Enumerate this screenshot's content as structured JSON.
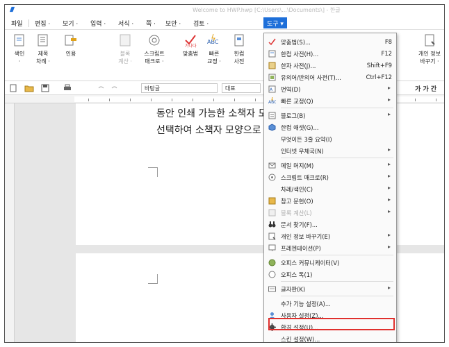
{
  "title_bar": {
    "text": "Welcome to HWP.hwp [C:\\Users\\...\\Documents\\] - 한글"
  },
  "menubar": {
    "items": [
      {
        "label": "파일"
      },
      {
        "label": "편집 ·"
      },
      {
        "label": "보기 ·"
      },
      {
        "label": "입력 ·"
      },
      {
        "label": "서식 ·"
      },
      {
        "label": "쪽 ·"
      },
      {
        "label": "보안 ·"
      },
      {
        "label": "검토 ·"
      },
      {
        "label": "도구 ▾"
      }
    ]
  },
  "ribbon": {
    "buttons": [
      {
        "label": "색인",
        "label2": "·"
      },
      {
        "label": "제목",
        "label2": "차례 ·"
      },
      {
        "label": "인용",
        "label2": ""
      },
      {
        "label": "블록",
        "label2": "계산 ·"
      },
      {
        "label": "스크립트",
        "label2": "매크로 ·"
      },
      {
        "label": "맞춤법",
        "label2": ""
      },
      {
        "label": "빠른",
        "label2": "교정 ·"
      },
      {
        "label": "한컴",
        "label2": "사전"
      },
      {
        "label": "개인 정보",
        "label2": "바꾸기 ·"
      }
    ]
  },
  "toolbar": {
    "style_value": "바탕글",
    "outline_value": "대표",
    "right_glyphs": "가 가 간"
  },
  "document": {
    "line1": "동안 인쇄 가능한 소책자 모양으로 출력할 수 있는 모양으로",
    "line2": "선택하여 소책자 모양으로"
  },
  "dropdown": {
    "items": [
      {
        "label": "맞춤법(S)...",
        "shortcut": "F8",
        "arrow": "",
        "icon": "spellcheck-icon",
        "dim": false
      },
      {
        "label": "한컴 사전(H)...",
        "shortcut": "F12",
        "arrow": "",
        "icon": "dictionary-icon",
        "dim": false
      },
      {
        "label": "한자 사전(J)...",
        "shortcut": "Shift+F9",
        "arrow": "",
        "icon": "hanja-icon",
        "dim": false
      },
      {
        "label": "유의어/반의어 사전(T)...",
        "shortcut": "Ctrl+F12",
        "arrow": "",
        "icon": "thesaurus-icon",
        "dim": false
      },
      {
        "label": "번역(D)",
        "shortcut": "",
        "arrow": "▸",
        "icon": "translate-icon",
        "dim": false
      },
      {
        "label": "빠른 교정(Q)",
        "shortcut": "",
        "arrow": "▸",
        "icon": "quick-correct-icon",
        "dim": false
      },
      {
        "label": "블로그(B)",
        "shortcut": "",
        "arrow": "▸",
        "icon": "blog-icon",
        "dim": false
      },
      {
        "label": "한컴 애셋(G)...",
        "shortcut": "",
        "arrow": "",
        "icon": "asset-icon",
        "dim": false
      },
      {
        "label": "무엇이든 3줄 요약(I)",
        "shortcut": "",
        "arrow": "",
        "icon": "",
        "dim": false
      },
      {
        "label": "인터넷 우체국(N)",
        "shortcut": "",
        "arrow": "▸",
        "icon": "",
        "dim": false
      },
      {
        "label": "메일 머지(M)",
        "shortcut": "",
        "arrow": "▸",
        "icon": "mail-icon",
        "dim": false
      },
      {
        "label": "스크립트 매크로(R)",
        "shortcut": "",
        "arrow": "▸",
        "icon": "macro-icon",
        "dim": false
      },
      {
        "label": "차례/색인(C)",
        "shortcut": "",
        "arrow": "▸",
        "icon": "",
        "dim": false
      },
      {
        "label": "참고 문헌(O)",
        "shortcut": "",
        "arrow": "▸",
        "icon": "reference-icon",
        "dim": false
      },
      {
        "label": "블록 계산(L)",
        "shortcut": "",
        "arrow": "▸",
        "icon": "block-calc-icon",
        "dim": true
      },
      {
        "label": "문서 찾기(F)...",
        "shortcut": "",
        "arrow": "",
        "icon": "binoculars-icon",
        "dim": false
      },
      {
        "label": "개인 정보 바꾸기(E)",
        "shortcut": "",
        "arrow": "▸",
        "icon": "privacy-icon",
        "dim": false
      },
      {
        "label": "프레젠테이션(P)",
        "shortcut": "",
        "arrow": "▸",
        "icon": "presentation-icon",
        "dim": false
      },
      {
        "label": "오피스 커뮤니케이터(V)",
        "shortcut": "",
        "arrow": "",
        "icon": "communicator-icon",
        "dim": false
      },
      {
        "label": "오피스 톡(1)",
        "shortcut": "",
        "arrow": "",
        "icon": "talk-icon",
        "dim": false
      },
      {
        "label": "글자판(K)",
        "shortcut": "",
        "arrow": "▸",
        "icon": "keyboard-icon",
        "dim": false
      },
      {
        "label": "추가 기능 설정(A)...",
        "shortcut": "",
        "arrow": "",
        "icon": "",
        "dim": false
      },
      {
        "label": "사용자 설정(Z)...",
        "shortcut": "",
        "arrow": "",
        "icon": "user-settings-icon",
        "dim": false
      },
      {
        "label": "환경 설정(U)...",
        "shortcut": "",
        "arrow": "",
        "icon": "gear-icon",
        "dim": false
      },
      {
        "label": "스킨 설정(W)...",
        "shortcut": "",
        "arrow": "",
        "icon": "",
        "dim": false
      }
    ]
  },
  "colors": {
    "accent": "#1e6fd9",
    "highlight_border": "#e0302d"
  }
}
